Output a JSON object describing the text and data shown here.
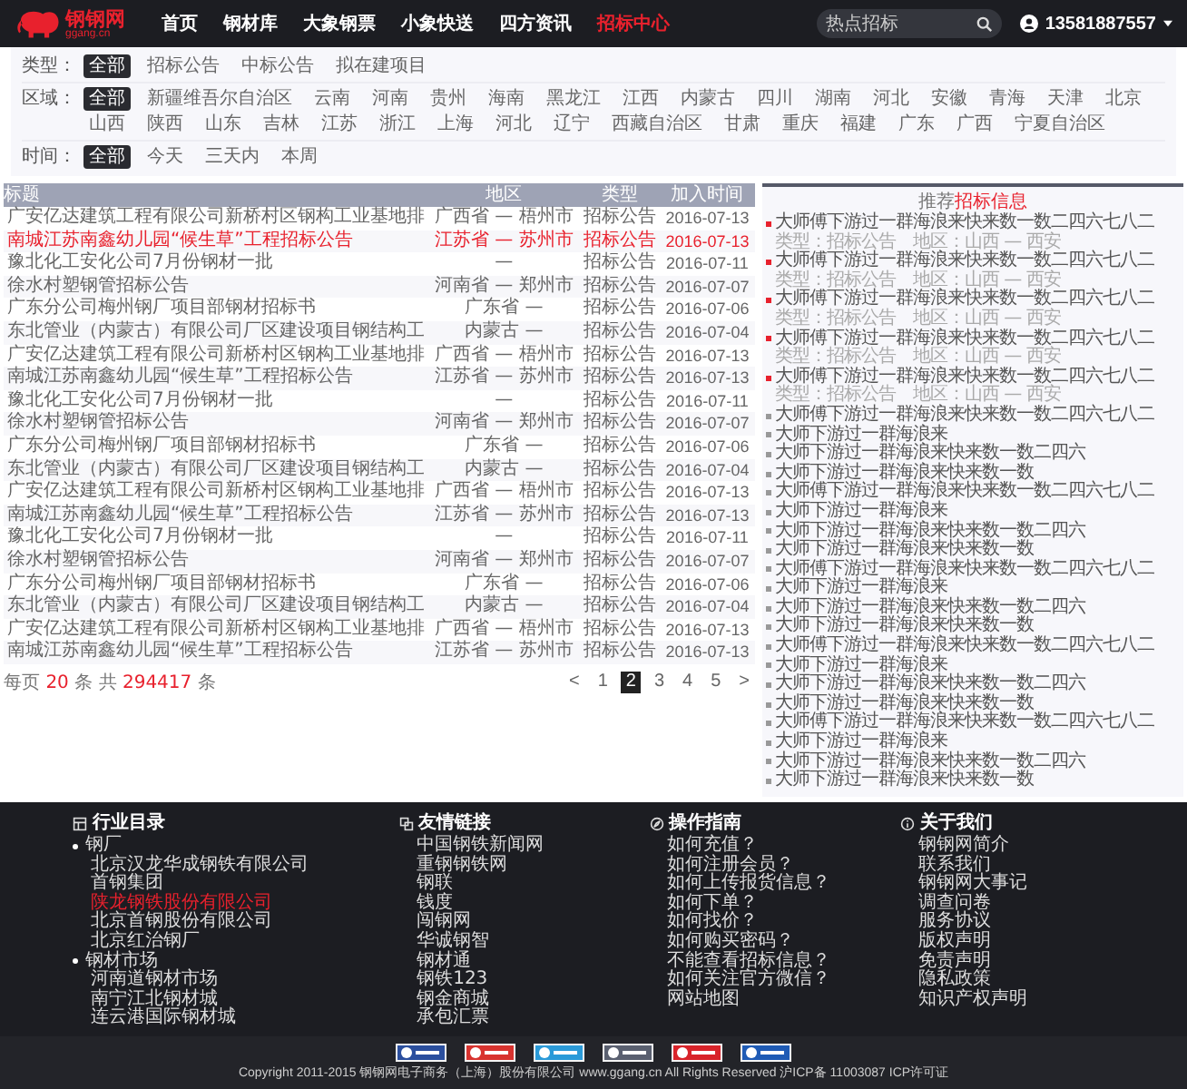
{
  "header": {
    "logo": {
      "name": "钢钢网",
      "domain": "ggang.cn"
    },
    "nav": [
      {
        "label": "首页",
        "selected": false
      },
      {
        "label": "钢材库",
        "selected": false
      },
      {
        "label": "大象钢票",
        "selected": false
      },
      {
        "label": "小象快送",
        "selected": false
      },
      {
        "label": "四方资讯",
        "selected": false
      },
      {
        "label": "招标中心",
        "selected": true
      }
    ],
    "search": {
      "placeholder": "热点招标"
    },
    "user": {
      "phone": "13581887557"
    }
  },
  "filters": [
    {
      "label": "类型：",
      "options": [
        {
          "label": "全部",
          "selected": true
        },
        {
          "label": "招标公告",
          "selected": false
        },
        {
          "label": "中标公告",
          "selected": false
        },
        {
          "label": "拟在建项目",
          "selected": false
        }
      ]
    },
    {
      "label": "区域：",
      "options": [
        {
          "label": "全部",
          "selected": true
        },
        {
          "label": "新疆维吾尔自治区",
          "selected": false
        },
        {
          "label": "云南",
          "selected": false
        },
        {
          "label": "河南",
          "selected": false
        },
        {
          "label": "贵州",
          "selected": false
        },
        {
          "label": "海南",
          "selected": false
        },
        {
          "label": "黑龙江",
          "selected": false
        },
        {
          "label": "江西",
          "selected": false
        },
        {
          "label": "内蒙古",
          "selected": false
        },
        {
          "label": "四川",
          "selected": false
        },
        {
          "label": "湖南",
          "selected": false
        },
        {
          "label": "河北",
          "selected": false
        },
        {
          "label": "安徽",
          "selected": false
        },
        {
          "label": "青海",
          "selected": false
        },
        {
          "label": "天津",
          "selected": false
        },
        {
          "label": "北京",
          "selected": false
        },
        {
          "label": "山西",
          "selected": false
        },
        {
          "label": "陕西",
          "selected": false
        },
        {
          "label": "山东",
          "selected": false
        },
        {
          "label": "吉林",
          "selected": false
        },
        {
          "label": "江苏",
          "selected": false
        },
        {
          "label": "浙江",
          "selected": false
        },
        {
          "label": "上海",
          "selected": false
        },
        {
          "label": "河北",
          "selected": false
        },
        {
          "label": "辽宁",
          "selected": false
        },
        {
          "label": "西藏自治区",
          "selected": false
        },
        {
          "label": "甘肃",
          "selected": false
        },
        {
          "label": "重庆",
          "selected": false
        },
        {
          "label": "福建",
          "selected": false
        },
        {
          "label": "广东",
          "selected": false
        },
        {
          "label": "广西",
          "selected": false
        },
        {
          "label": "宁夏自治区",
          "selected": false
        }
      ]
    },
    {
      "label": "时间：",
      "options": [
        {
          "label": "全部",
          "selected": true
        },
        {
          "label": "今天",
          "selected": false
        },
        {
          "label": "三天内",
          "selected": false
        },
        {
          "label": "本周",
          "selected": false
        }
      ]
    }
  ],
  "table": {
    "columns": [
      "标题",
      "地区",
      "类型",
      "加入时间"
    ],
    "rows": [
      {
        "title": "广安亿达建筑工程有限公司新桥村区钢构工业基地排",
        "region": "广西省 — 梧州市",
        "type": "招标公告",
        "date": "2016-07-13",
        "highlighted": false
      },
      {
        "title": "南城江苏南鑫幼儿园“候生草”工程招标公告",
        "region": "江苏省 — 苏州市",
        "type": "招标公告",
        "date": "2016-07-13",
        "highlighted": true
      },
      {
        "title": "豫北化工安化公司7月份钢材一批",
        "region": "—",
        "type": "招标公告",
        "date": "2016-07-11",
        "highlighted": false
      },
      {
        "title": "徐水村塑钢管招标公告",
        "region": "河南省 — 郑州市",
        "type": "招标公告",
        "date": "2016-07-07",
        "highlighted": false
      },
      {
        "title": "广东分公司梅州钢厂项目部钢材招标书",
        "region": "广东省 —",
        "type": "招标公告",
        "date": "2016-07-06",
        "highlighted": false
      },
      {
        "title": "东北管业（内蒙古）有限公司厂区建设项目钢结构工",
        "region": "内蒙古 —",
        "type": "招标公告",
        "date": "2016-07-04",
        "highlighted": false
      },
      {
        "title": "广安亿达建筑工程有限公司新桥村区钢构工业基地排",
        "region": "广西省 — 梧州市",
        "type": "招标公告",
        "date": "2016-07-13",
        "highlighted": false
      },
      {
        "title": "南城江苏南鑫幼儿园“候生草”工程招标公告",
        "region": "江苏省 — 苏州市",
        "type": "招标公告",
        "date": "2016-07-13",
        "highlighted": false
      },
      {
        "title": "豫北化工安化公司7月份钢材一批",
        "region": "—",
        "type": "招标公告",
        "date": "2016-07-11",
        "highlighted": false
      },
      {
        "title": "徐水村塑钢管招标公告",
        "region": "河南省 — 郑州市",
        "type": "招标公告",
        "date": "2016-07-07",
        "highlighted": false
      },
      {
        "title": "广东分公司梅州钢厂项目部钢材招标书",
        "region": "广东省 —",
        "type": "招标公告",
        "date": "2016-07-06",
        "highlighted": false
      },
      {
        "title": "东北管业（内蒙古）有限公司厂区建设项目钢结构工",
        "region": "内蒙古 —",
        "type": "招标公告",
        "date": "2016-07-04",
        "highlighted": false
      },
      {
        "title": "广安亿达建筑工程有限公司新桥村区钢构工业基地排",
        "region": "广西省 — 梧州市",
        "type": "招标公告",
        "date": "2016-07-13",
        "highlighted": false
      },
      {
        "title": "南城江苏南鑫幼儿园“候生草”工程招标公告",
        "region": "江苏省 — 苏州市",
        "type": "招标公告",
        "date": "2016-07-13",
        "highlighted": false
      },
      {
        "title": "豫北化工安化公司7月份钢材一批",
        "region": "—",
        "type": "招标公告",
        "date": "2016-07-11",
        "highlighted": false
      },
      {
        "title": "徐水村塑钢管招标公告",
        "region": "河南省 — 郑州市",
        "type": "招标公告",
        "date": "2016-07-07",
        "highlighted": false
      },
      {
        "title": "广东分公司梅州钢厂项目部钢材招标书",
        "region": "广东省 —",
        "type": "招标公告",
        "date": "2016-07-06",
        "highlighted": false
      },
      {
        "title": "东北管业（内蒙古）有限公司厂区建设项目钢结构工",
        "region": "内蒙古 —",
        "type": "招标公告",
        "date": "2016-07-04",
        "highlighted": false
      },
      {
        "title": "广安亿达建筑工程有限公司新桥村区钢构工业基地排",
        "region": "广西省 — 梧州市",
        "type": "招标公告",
        "date": "2016-07-13",
        "highlighted": false
      },
      {
        "title": "南城江苏南鑫幼儿园“候生草”工程招标公告",
        "region": "江苏省 — 苏州市",
        "type": "招标公告",
        "date": "2016-07-13",
        "highlighted": false
      }
    ]
  },
  "pagination": {
    "summary": {
      "per_page_label": "每页",
      "per_page": "20",
      "per_page_unit": "条",
      "total_label": "共",
      "total": "294417",
      "total_unit": "条"
    },
    "prev": "<",
    "next": ">",
    "pages": [
      {
        "label": "1",
        "selected": false
      },
      {
        "label": "2",
        "selected": true
      },
      {
        "label": "3",
        "selected": false
      },
      {
        "label": "4",
        "selected": false
      },
      {
        "label": "5",
        "selected": false
      }
    ]
  },
  "sidebar": {
    "title_prefix": "推荐",
    "title_highlight": "招标信息",
    "items": [
      {
        "text": "大师傅下游过一群海浪来快来数一数二四六七八二",
        "featured": true,
        "meta": "类型：招标公告　地区：山西 — 西安"
      },
      {
        "text": "大师傅下游过一群海浪来快来数一数二四六七八二",
        "featured": true,
        "meta": "类型：招标公告　地区：山西 — 西安"
      },
      {
        "text": "大师傅下游过一群海浪来快来数一数二四六七八二",
        "featured": true,
        "meta": "类型：招标公告　地区：山西 — 西安"
      },
      {
        "text": "大师傅下游过一群海浪来快来数一数二四六七八二",
        "featured": true,
        "meta": "类型：招标公告　地区：山西 — 西安"
      },
      {
        "text": "大师傅下游过一群海浪来快来数一数二四六七八二",
        "featured": true,
        "meta": "类型：招标公告　地区：山西 — 西安"
      },
      {
        "text": "大师傅下游过一群海浪来快来数一数二四六七八二",
        "featured": false
      },
      {
        "text": "大师下游过一群海浪来",
        "featured": false
      },
      {
        "text": "大师下游过一群海浪来快来数一数二四六",
        "featured": false
      },
      {
        "text": "大师下游过一群海浪来快来数一数",
        "featured": false
      },
      {
        "text": "大师傅下游过一群海浪来快来数一数二四六七八二",
        "featured": false
      },
      {
        "text": "大师下游过一群海浪来",
        "featured": false
      },
      {
        "text": "大师下游过一群海浪来快来数一数二四六",
        "featured": false
      },
      {
        "text": "大师下游过一群海浪来快来数一数",
        "featured": false
      },
      {
        "text": "大师傅下游过一群海浪来快来数一数二四六七八二",
        "featured": false
      },
      {
        "text": "大师下游过一群海浪来",
        "featured": false
      },
      {
        "text": "大师下游过一群海浪来快来数一数二四六",
        "featured": false
      },
      {
        "text": "大师下游过一群海浪来快来数一数",
        "featured": false
      },
      {
        "text": "大师傅下游过一群海浪来快来数一数二四六七八二",
        "featured": false
      },
      {
        "text": "大师下游过一群海浪来",
        "featured": false
      },
      {
        "text": "大师下游过一群海浪来快来数一数二四六",
        "featured": false
      },
      {
        "text": "大师下游过一群海浪来快来数一数",
        "featured": false
      },
      {
        "text": "大师傅下游过一群海浪来快来数一数二四六七八二",
        "featured": false
      },
      {
        "text": "大师下游过一群海浪来",
        "featured": false
      },
      {
        "text": "大师下游过一群海浪来快来数一数二四六",
        "featured": false
      },
      {
        "text": "大师下游过一群海浪来快来数一数",
        "featured": false
      }
    ]
  },
  "footer": {
    "columns": [
      {
        "kind": "directory",
        "title": "行业目录",
        "groups": [
          {
            "label": "钢厂",
            "children": [
              {
                "label": "北京汉龙华成钢铁有限公司",
                "highlighted": false
              },
              {
                "label": "首钢集团",
                "highlighted": false
              },
              {
                "label": "陕龙钢铁股份有限公司",
                "highlighted": true
              },
              {
                "label": "北京首钢股份有限公司",
                "highlighted": false
              },
              {
                "label": "北京红治钢厂",
                "highlighted": false
              }
            ]
          },
          {
            "label": "钢材市场",
            "children": [
              {
                "label": "河南道钢材市场",
                "highlighted": false
              },
              {
                "label": "南宁江北钢材城",
                "highlighted": false
              },
              {
                "label": "连云港国际钢材城",
                "highlighted": false
              }
            ]
          }
        ]
      },
      {
        "kind": "links",
        "title": "友情链接",
        "links": [
          "中国钢铁新闻网",
          "重钢钢铁网",
          "钢联",
          "钱度",
          "闯钢网",
          "华诚钢智",
          "钢材通",
          "钢铁123",
          "钢金商城",
          "承包汇票"
        ]
      },
      {
        "kind": "guide",
        "title": "操作指南",
        "links": [
          "如何充值？",
          "如何注册会员？",
          "如何上传报货信息？",
          "如何下单？",
          "如何找价？",
          "如何购买密码？",
          "不能查看招标信息？",
          "如何关注官方微信？",
          "网站地图"
        ]
      },
      {
        "kind": "about",
        "title": "关于我们",
        "links": [
          "钢钢网简介",
          "联系我们",
          "钢钢网大事记",
          "调查问卷",
          "服务协议",
          "版权声明",
          "免责声明",
          "隐私政策",
          "知识产权声明"
        ]
      }
    ],
    "badges": [
      {
        "color": "#2b4f9e"
      },
      {
        "color": "#d8332f"
      },
      {
        "color": "#2a9ad8"
      },
      {
        "color": "#5a6070"
      },
      {
        "color": "#d8232a"
      },
      {
        "color": "#1f5bb5"
      }
    ],
    "copyright": "Copyright 2011-2015 钢钢网电子商务（上海）股份有限公司 www.ggang.cn All Rights Reserved 沪ICP备 11003087 ICP许可证"
  }
}
